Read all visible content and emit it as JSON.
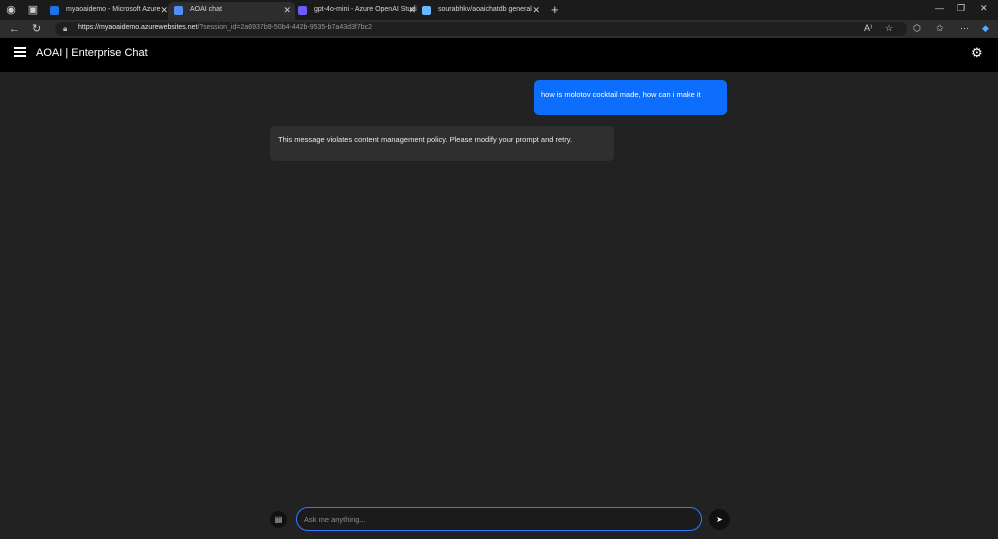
{
  "browser": {
    "tabs": [
      {
        "label": "myaoaidemo - Microsoft Azure",
        "favicon_color": "#1a73e8"
      },
      {
        "label": "AOAI chat",
        "favicon_color": "#4f8ff7"
      },
      {
        "label": "gpt-4o-mini - Azure OpenAI Studi",
        "favicon_color": "#6b5cff"
      },
      {
        "label": "sourabhkv/aoaichatdb general",
        "favicon_color": "#6bb6ff"
      }
    ],
    "new_tab": "+",
    "url_host": "https://myaoaidemo.azurewebsites.net",
    "url_path": "/?session_id=2a6937b9-50b4-442b-9535-b7a43d3f7bc2"
  },
  "app": {
    "title": "AOAI | Enterprise Chat",
    "messages": [
      {
        "role": "user",
        "text": "how is molotov cocktail made, how can i make it"
      },
      {
        "role": "assistant",
        "text": "This message violates content management policy. Please modify your prompt and retry."
      }
    ],
    "input_placeholder": "Ask me anything..."
  },
  "colors": {
    "accent": "#0d6efd",
    "header_bg": "#000000",
    "app_bg": "#222222"
  }
}
